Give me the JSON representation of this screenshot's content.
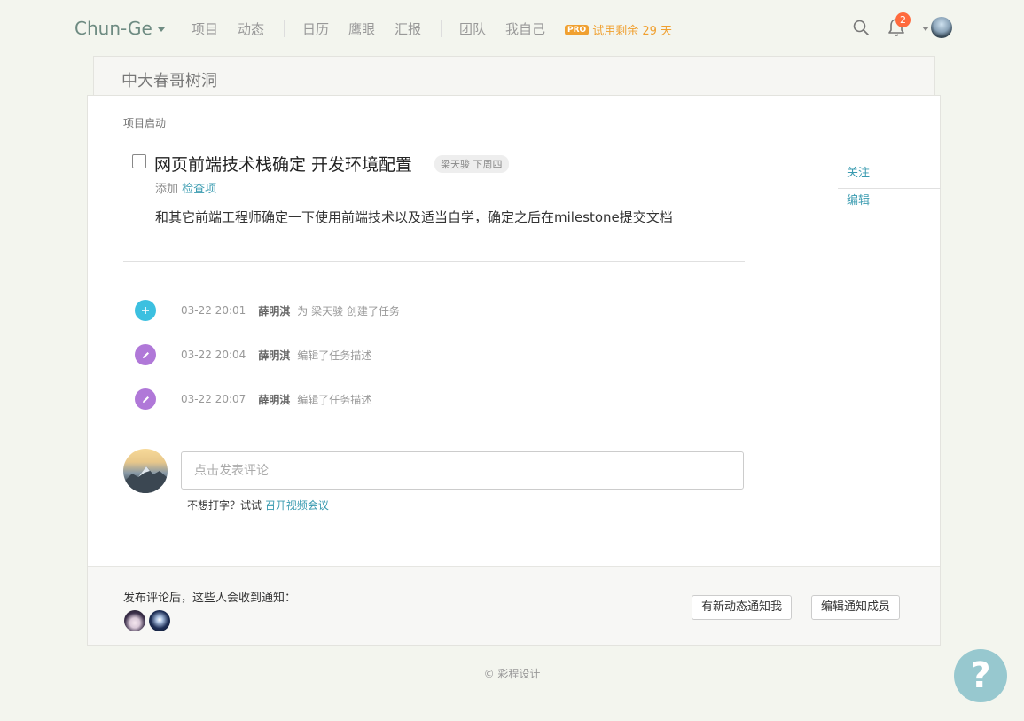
{
  "nav": {
    "brand": "Chun-Ge",
    "items": [
      "项目",
      "动态",
      "日历",
      "鹰眼",
      "汇报",
      "团队",
      "我自己"
    ],
    "pro_badge": "PRO",
    "trial_text": "试用剩余 29 天",
    "notification_count": "2",
    "icons": {
      "search": "search-icon",
      "bell": "bell-icon"
    }
  },
  "project": {
    "title": "中大春哥树洞"
  },
  "task": {
    "breadcrumb": "项目启动",
    "title": "网页前端技术栈确定 开发环境配置",
    "tag": "梁天骏 下周四",
    "add_prefix": "添加",
    "add_link": "检查项",
    "description": "和其它前端工程师确定一下使用前端技术以及适当自学，确定之后在milestone提交文档"
  },
  "side_actions": [
    "关注",
    "编辑"
  ],
  "activities": [
    {
      "icon": "plus-icon",
      "time": "03-22 20:01",
      "user": "薛明淇",
      "text": "为 梁天骏 创建了任务"
    },
    {
      "icon": "pencil-icon",
      "time": "03-22 20:04",
      "user": "薛明淇",
      "text": "编辑了任务描述"
    },
    {
      "icon": "pencil-icon",
      "time": "03-22 20:07",
      "user": "薛明淇",
      "text": "编辑了任务描述"
    }
  ],
  "comment": {
    "placeholder": "点击发表评论",
    "hint_prefix": "不想打字？试试",
    "hint_link": "召开视频会议"
  },
  "footer": {
    "notify_text": "发布评论后，这些人会收到通知：",
    "btn_notify_me": "有新动态通知我",
    "btn_edit_members": "编辑通知成员"
  },
  "copyright": "© 彩程设计",
  "help": "?",
  "colors": {
    "accent": "#3a9bb0",
    "brand": "#6e8b82",
    "pro": "#f0a030",
    "badge": "#ff6a3d"
  }
}
